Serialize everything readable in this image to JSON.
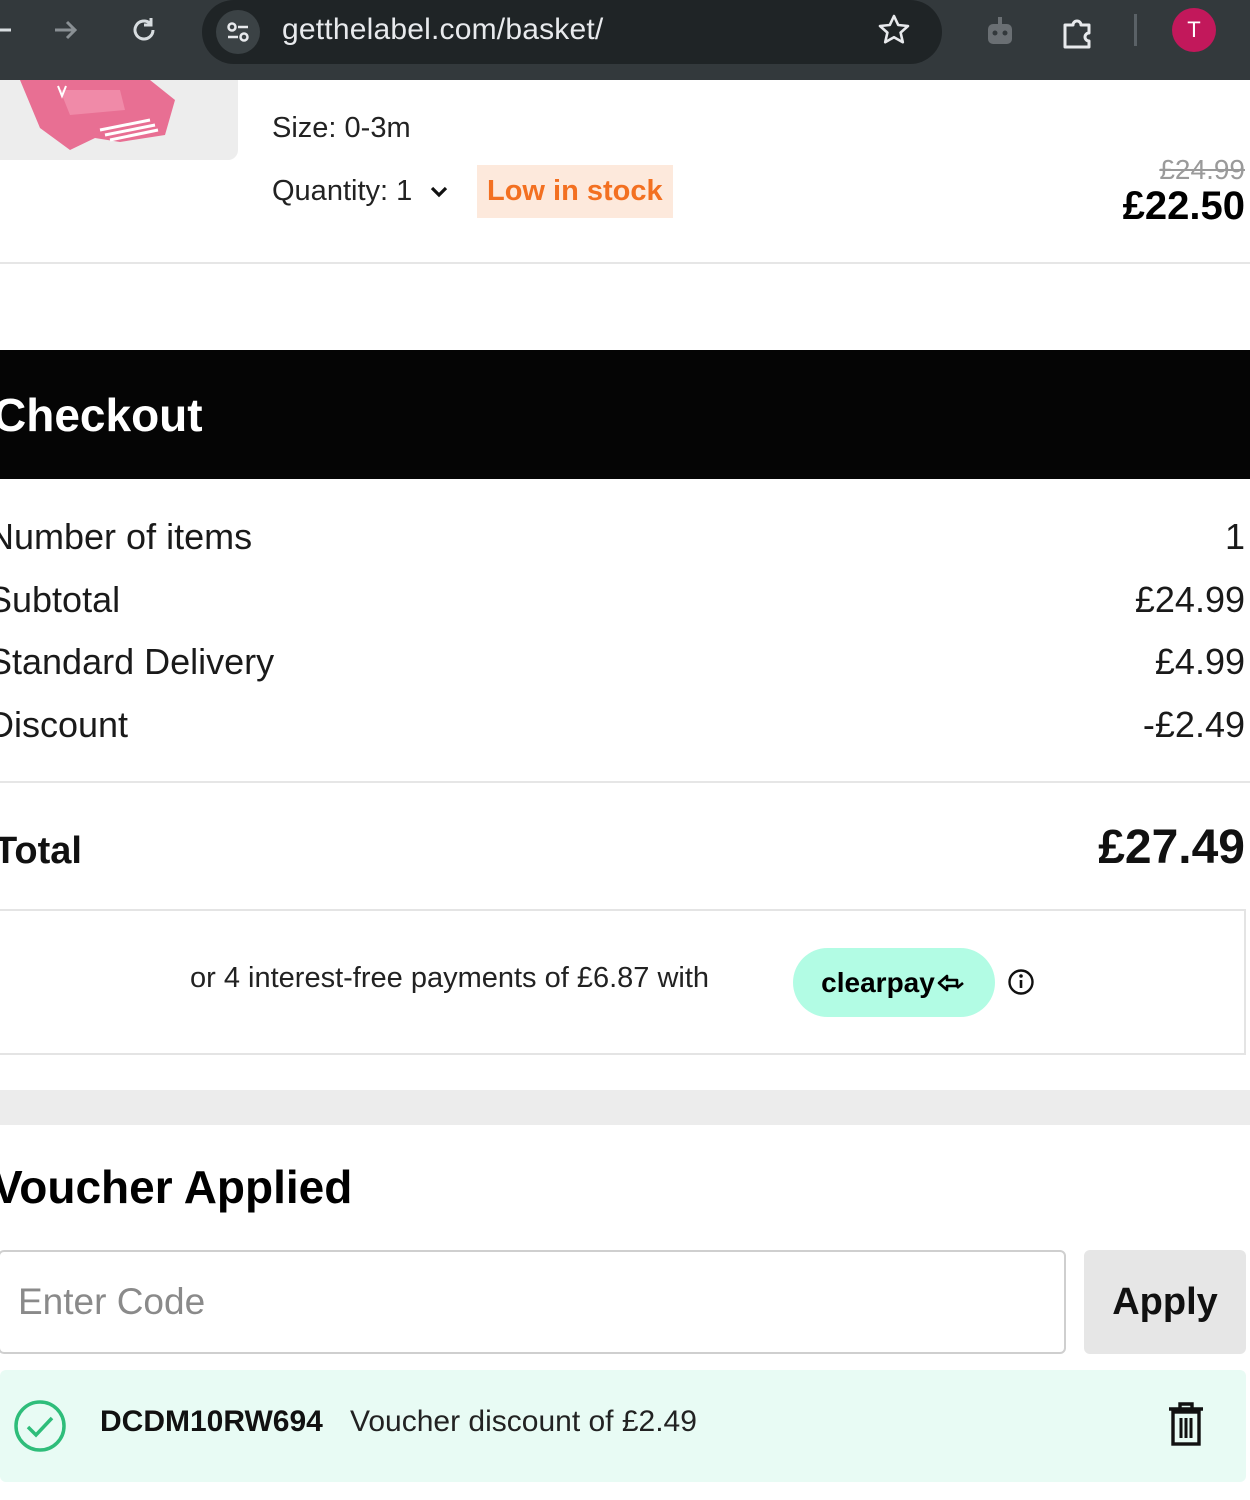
{
  "browser": {
    "url": "getthelabel.com/basket/",
    "avatar_letter": "T"
  },
  "product": {
    "size": "Size: 0-3m",
    "quantity": "Quantity: 1",
    "stock_badge": "Low in stock",
    "old_price": "£24.99",
    "price": "£22.50"
  },
  "checkout": {
    "title": "Checkout",
    "rows": [
      {
        "label": "Number of items",
        "value": "1"
      },
      {
        "label": "Subtotal",
        "value": "£24.99"
      },
      {
        "label": "Standard Delivery",
        "value": "£4.99"
      },
      {
        "label": "Discount",
        "value": "-£2.49"
      }
    ],
    "total_label": "Total",
    "total_value": "£27.49"
  },
  "clearpay": {
    "text": "or 4 interest-free payments of £6.87 with",
    "brand": "clearpay"
  },
  "voucher": {
    "title": "Voucher Applied",
    "placeholder": "Enter Code",
    "apply_label": "Apply",
    "applied_code": "DCDM10RW694",
    "applied_desc": "Voucher discount of £2.49"
  },
  "colors": {
    "stock_badge_text": "#f37021",
    "stock_badge_bg": "#fde9dc",
    "clearpay_mint": "#b2fce4",
    "success_green": "#2ebd7a",
    "avatar": "#c2185b"
  }
}
